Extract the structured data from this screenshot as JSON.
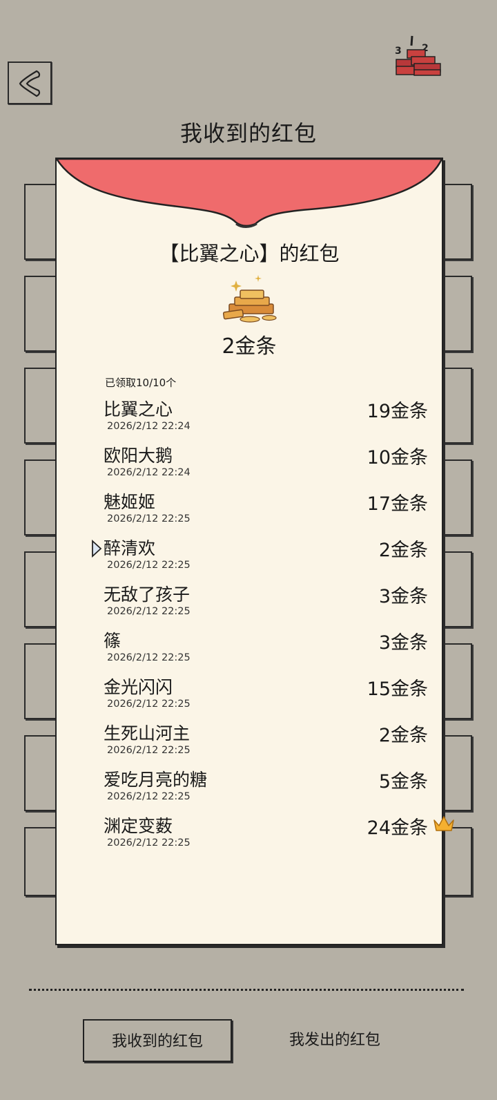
{
  "header": {
    "title": "我收到的红包"
  },
  "modal": {
    "sender_title": "【比翼之心】的红包",
    "total": "2金条",
    "claimed": "已领取10/10个",
    "entries": [
      {
        "name": "比翼之心",
        "time": "2026/2/12 22:24",
        "amount": "19金条"
      },
      {
        "name": "欧阳大鹅",
        "time": "2026/2/12 22:24",
        "amount": "10金条"
      },
      {
        "name": "魅姬姬",
        "time": "2026/2/12 22:25",
        "amount": "17金条"
      },
      {
        "name": "醉清欢",
        "time": "2026/2/12 22:25",
        "amount": "2金条"
      },
      {
        "name": "无敌了孩子",
        "time": "2026/2/12 22:25",
        "amount": "3金条"
      },
      {
        "name": "篠",
        "time": "2026/2/12 22:25",
        "amount": "3金条"
      },
      {
        "name": "金光闪闪",
        "time": "2026/2/12 22:25",
        "amount": "15金条"
      },
      {
        "name": "生死山河主",
        "time": "2026/2/12 22:25",
        "amount": "2金条"
      },
      {
        "name": "爱吃月亮的糖",
        "time": "2026/2/12 22:25",
        "amount": "5金条"
      },
      {
        "name": "渊定变薮",
        "time": "2026/2/12 22:25",
        "amount": "24金条"
      }
    ]
  },
  "tabs": {
    "received": "我收到的红包",
    "sent": "我发出的红包"
  },
  "icons": {
    "back": "back-arrow-icon",
    "cash": "cash-stack-icon",
    "gold": "gold-bars-icon",
    "crown": "crown-icon",
    "pointer": "pointer-arrow-icon"
  },
  "colors": {
    "background": "#b5b0a5",
    "envelope_flap": "#ef6b6c",
    "paper": "#fbf5e7",
    "crown": "#f0a020"
  }
}
